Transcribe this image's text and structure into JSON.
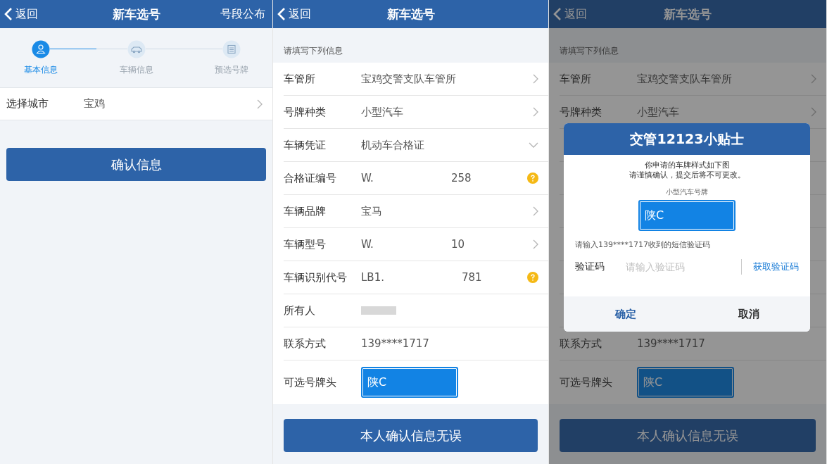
{
  "screens": [
    {
      "header": {
        "back": "返回",
        "title": "新车选号",
        "action": "号段公布"
      },
      "steps": [
        {
          "label": "基本信息",
          "kind": "person",
          "selected": true
        },
        {
          "label": "车辆信息",
          "kind": "car",
          "selected": false
        },
        {
          "label": "预选号牌",
          "kind": "list",
          "selected": false
        }
      ],
      "rows": [
        {
          "kind": "chevron",
          "label": "选择城市",
          "value": "宝鸡"
        }
      ],
      "button": "确认信息"
    },
    {
      "header": {
        "back": "返回",
        "title": "新车选号"
      },
      "section_title": "请填写下列信息",
      "rows": [
        {
          "kind": "chevron",
          "label": "车管所",
          "value": "宝鸡交警支队车管所"
        },
        {
          "kind": "chevron",
          "label": "号牌种类",
          "value": "小型汽车"
        },
        {
          "kind": "dropdown",
          "label": "车辆凭证",
          "value": "机动车合格证"
        },
        {
          "kind": "help",
          "label": "合格证编号",
          "value": "W.",
          "value_end": "258"
        },
        {
          "kind": "chevron",
          "label": "车辆品牌",
          "value": "宝马"
        },
        {
          "kind": "chevron",
          "label": "车辆型号",
          "value": "W.",
          "value_end": "10"
        },
        {
          "kind": "help",
          "label": "车辆识别代号",
          "value": "LB1.",
          "value_end": "781"
        },
        {
          "kind": "redacted",
          "label": "所有人"
        },
        {
          "kind": "plain",
          "label": "联系方式",
          "value": "139****1717"
        },
        {
          "kind": "plate",
          "label": "可选号牌头",
          "value": "陕C"
        }
      ],
      "button": "本人确认信息无误"
    },
    {
      "header": {
        "back": "返回",
        "title": "新车选号"
      },
      "section_title": "请填写下列信息",
      "rows": [
        {
          "kind": "chevron",
          "label": "车管所",
          "value": "宝鸡交警支队车管所"
        },
        {
          "kind": "chevron",
          "label": "号牌种类",
          "value": "小型汽车"
        },
        {
          "kind": "covered"
        },
        {
          "kind": "covered"
        },
        {
          "kind": "covered"
        },
        {
          "kind": "covered"
        },
        {
          "kind": "covered"
        },
        {
          "kind": "covered"
        },
        {
          "kind": "plain",
          "label": "联系方式",
          "value": "139****1717"
        },
        {
          "kind": "plate",
          "label": "可选号牌头",
          "value": "陕C"
        }
      ],
      "button": "本人确认信息无误",
      "dialog": {
        "title": "交管12123小贴士",
        "message_lines": [
          "你申请的车牌样式如下图",
          "请谨慎确认，提交后将不可更改。"
        ],
        "plate_caption": "小型汽车号牌",
        "plate": "陕C",
        "sms_hint": "请输入139****1717收到的短信验证码",
        "code_label": "验证码",
        "code_placeholder": "请输入验证码",
        "get_code": "获取验证码",
        "confirm": "确定",
        "cancel": "取消"
      }
    }
  ]
}
